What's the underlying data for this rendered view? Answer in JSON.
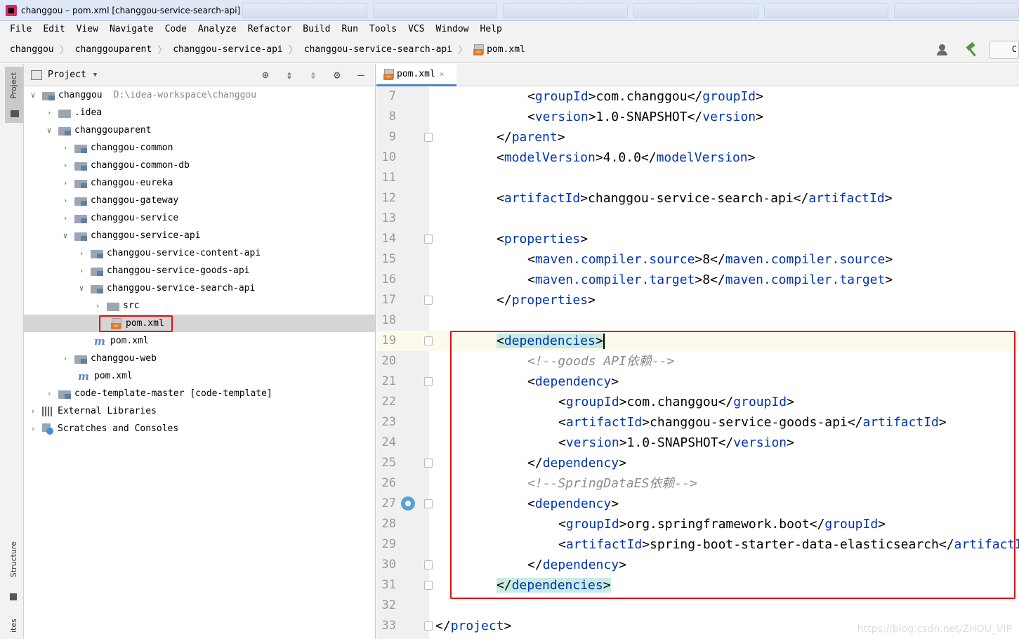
{
  "window": {
    "title": "changgou – pom.xml [changgou-service-search-api]"
  },
  "menu": [
    "File",
    "Edit",
    "View",
    "Navigate",
    "Code",
    "Analyze",
    "Refactor",
    "Build",
    "Run",
    "Tools",
    "VCS",
    "Window",
    "Help"
  ],
  "breadcrumbs": [
    "changgou",
    "changgouparent",
    "changgou-service-api",
    "changgou-service-search-api",
    "pom.xml"
  ],
  "project_panel": {
    "title": "Project",
    "tree": [
      {
        "label": "changgou",
        "path": "D:\\idea-workspace\\changgou"
      },
      {
        "label": ".idea"
      },
      {
        "label": "changgouparent"
      },
      {
        "label": "changgou-common"
      },
      {
        "label": "changgou-common-db"
      },
      {
        "label": "changgou-eureka"
      },
      {
        "label": "changgou-gateway"
      },
      {
        "label": "changgou-service"
      },
      {
        "label": "changgou-service-api"
      },
      {
        "label": "changgou-service-content-api"
      },
      {
        "label": "changgou-service-goods-api"
      },
      {
        "label": "changgou-service-search-api"
      },
      {
        "label": "src"
      },
      {
        "label": "pom.xml"
      },
      {
        "label": "pom.xml"
      },
      {
        "label": "changgou-web"
      },
      {
        "label": "pom.xml"
      },
      {
        "label": "code-template-master [code-template]"
      },
      {
        "label": "External Libraries"
      },
      {
        "label": "Scratches and Consoles"
      }
    ]
  },
  "tool_strip": {
    "project": "Project",
    "structure": "Structure",
    "favorites": "ites"
  },
  "editor": {
    "tab": "pom.xml",
    "lines": [
      {
        "n": "7",
        "pre": "<",
        "t1": "groupId",
        "mid": ">com.changgou</",
        "t2": "groupId",
        "post": ">"
      },
      {
        "n": "8",
        "pre": "<",
        "t1": "version",
        "mid": ">1.0-SNAPSHOT</",
        "t2": "version",
        "post": ">"
      },
      {
        "n": "9",
        "pre": "</",
        "t1": "parent",
        "mid": ">",
        "t2": "",
        "post": ""
      },
      {
        "n": "10",
        "pre": "<",
        "t1": "modelVersion",
        "mid": ">4.0.0</",
        "t2": "modelVersion",
        "post": ">"
      },
      {
        "n": "11",
        "pre": "",
        "t1": "",
        "mid": "",
        "t2": "",
        "post": ""
      },
      {
        "n": "12",
        "pre": "<",
        "t1": "artifactId",
        "mid": ">changgou-service-search-api</",
        "t2": "artifactId",
        "post": ">"
      },
      {
        "n": "13",
        "pre": "",
        "t1": "",
        "mid": "",
        "t2": "",
        "post": ""
      },
      {
        "n": "14",
        "pre": "<",
        "t1": "properties",
        "mid": ">",
        "t2": "",
        "post": ""
      },
      {
        "n": "15",
        "pre": "<",
        "t1": "maven.compiler.source",
        "mid": ">8</",
        "t2": "maven.compiler.source",
        "post": ">"
      },
      {
        "n": "16",
        "pre": "<",
        "t1": "maven.compiler.target",
        "mid": ">8</",
        "t2": "maven.compiler.target",
        "post": ">"
      },
      {
        "n": "17",
        "pre": "</",
        "t1": "properties",
        "mid": ">",
        "t2": "",
        "post": ""
      },
      {
        "n": "18",
        "pre": "",
        "t1": "",
        "mid": "",
        "t2": "",
        "post": ""
      },
      {
        "n": "19",
        "pre": "<",
        "t1": "dependencies",
        "mid": ">",
        "t2": "",
        "post": ""
      },
      {
        "n": "20",
        "comment": "<!--goods API依赖-->"
      },
      {
        "n": "21",
        "pre": "<",
        "t1": "dependency",
        "mid": ">",
        "t2": "",
        "post": ""
      },
      {
        "n": "22",
        "pre": "<",
        "t1": "groupId",
        "mid": ">com.changgou</",
        "t2": "groupId",
        "post": ">"
      },
      {
        "n": "23",
        "pre": "<",
        "t1": "artifactId",
        "mid": ">changgou-service-goods-api</",
        "t2": "artifactId",
        "post": ">"
      },
      {
        "n": "24",
        "pre": "<",
        "t1": "version",
        "mid": ">1.0-SNAPSHOT</",
        "t2": "version",
        "post": ">"
      },
      {
        "n": "25",
        "pre": "</",
        "t1": "dependency",
        "mid": ">",
        "t2": "",
        "post": ""
      },
      {
        "n": "26",
        "comment": "<!--SpringDataES依赖-->"
      },
      {
        "n": "27",
        "pre": "<",
        "t1": "dependency",
        "mid": ">",
        "t2": "",
        "post": ""
      },
      {
        "n": "28",
        "pre": "<",
        "t1": "groupId",
        "mid": ">org.springframework.boot</",
        "t2": "groupId",
        "post": ">"
      },
      {
        "n": "29",
        "pre": "<",
        "t1": "artifactId",
        "mid": ">spring-boot-starter-data-elasticsearch</",
        "t2": "artifactId",
        "post": ">"
      },
      {
        "n": "30",
        "pre": "</",
        "t1": "dependency",
        "mid": ">",
        "t2": "",
        "post": ""
      },
      {
        "n": "31",
        "pre": "</",
        "t1": "dependencies",
        "mid": ">",
        "t2": "",
        "post": ""
      },
      {
        "n": "32",
        "pre": "",
        "t1": "",
        "mid": "",
        "t2": "",
        "post": ""
      },
      {
        "n": "33",
        "pre": "</",
        "t1": "project",
        "mid": ">",
        "t2": "",
        "post": ""
      }
    ]
  },
  "watermark": "https://blog.csdn.net/ZHOU_VIP",
  "colors": {
    "tag": "#0033b3",
    "comment": "#8c8c8c",
    "highlight_box": "#e01010",
    "tag_highlight": "#c8ece4"
  }
}
